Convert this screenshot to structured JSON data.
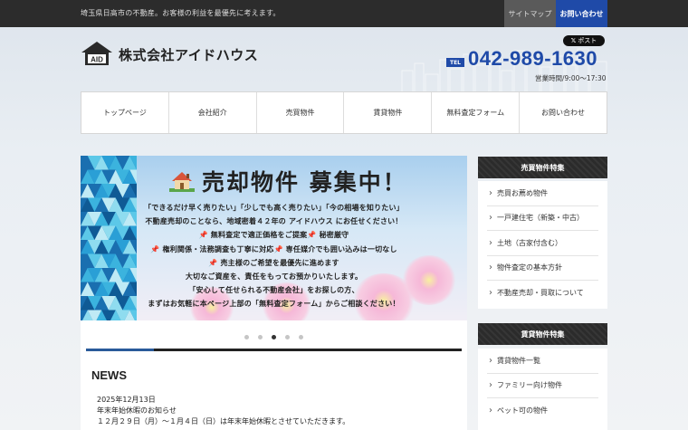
{
  "topbar": {
    "tagline": "埼玉県日高市の不動産。お客様の利益を最優先に考えます。",
    "sitemap_label": "サイトマップ",
    "contact_label": "お問い合わせ"
  },
  "header": {
    "logo_badge": "AID",
    "company_name": "株式会社アイドハウス",
    "x_post_label": "ポスト",
    "tel_label": "TEL",
    "tel_number": "042-989-1630",
    "hours": "営業時間/9:00～17:30"
  },
  "nav": {
    "items": [
      "トップページ",
      "会社紹介",
      "売買物件",
      "賃貸物件",
      "無料査定フォーム",
      "お問い合わせ"
    ]
  },
  "banner": {
    "title": "売却物件 募集中！",
    "lines": [
      "「できるだけ早く売りたい」「少しでも高く売りたい」「今の相場を知りたい」",
      "不動産売却のことなら、地域密着４２年の アイドハウス にお任せください！",
      "無料査定で適正価格をご提案",
      "秘密厳守",
      "権利関係・法務調査も丁寧に対応",
      "専任媒介でも囲い込みは一切なし",
      "売主様のご希望を最優先に進めます",
      "大切なご資産を、責任をもってお預かりいたします。",
      "「安心して任せられる不動産会社」をお探しの方、",
      "まずはお気軽に本ページ上部の「無料査定フォーム」からご相談ください！"
    ],
    "pin_icon": "📌",
    "slide_count": 5,
    "active_slide": 2,
    "progress": 0.18
  },
  "news": {
    "title": "NEWS",
    "items": [
      {
        "date": "2025年12月13日",
        "heading": "年末年始休暇のお知らせ",
        "body": "１２月２９日（月）～１月４日（日）は年末年始休暇とさせていただきます。"
      }
    ]
  },
  "sidebar": {
    "sales": {
      "title": "売買物件特集",
      "items": [
        "売買お薦め物件",
        "一戸建住宅（新築・中古）",
        "土地（古家付含む）",
        "物件査定の基本方針",
        "不動産売却・買取について"
      ]
    },
    "rental": {
      "title": "賃貸物件特集",
      "items": [
        "賃貸物件一覧",
        "ファミリー向け物件",
        "ペット可の物件"
      ]
    }
  },
  "colors": {
    "brand_blue": "#1f4aa8",
    "topbar": "#2c2c2c",
    "sidebar_header": "#2b2b2b"
  }
}
